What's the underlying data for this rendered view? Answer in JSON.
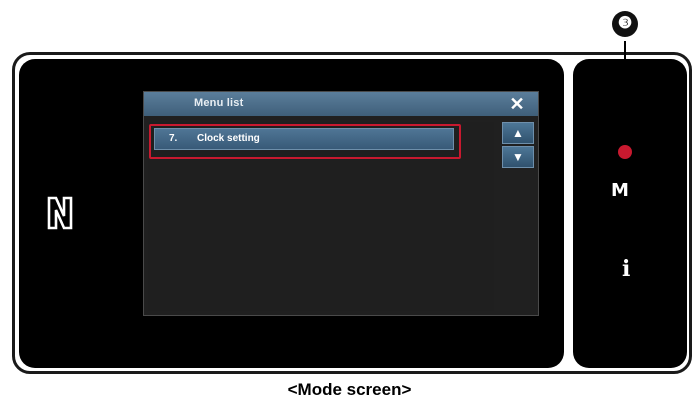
{
  "dialog": {
    "title": "Menu list",
    "close_label": "✕",
    "items": [
      {
        "number": "7.",
        "label": "Clock setting"
      }
    ],
    "scroll_up": "▲",
    "scroll_down": "▼"
  },
  "side_keys": {
    "mode_label": "M",
    "info_label": "i"
  },
  "callout": {
    "badge": "❸"
  },
  "caption": "<Mode screen>",
  "colors": {
    "highlight": "#c8192f",
    "title_bar": "#4f7595"
  }
}
